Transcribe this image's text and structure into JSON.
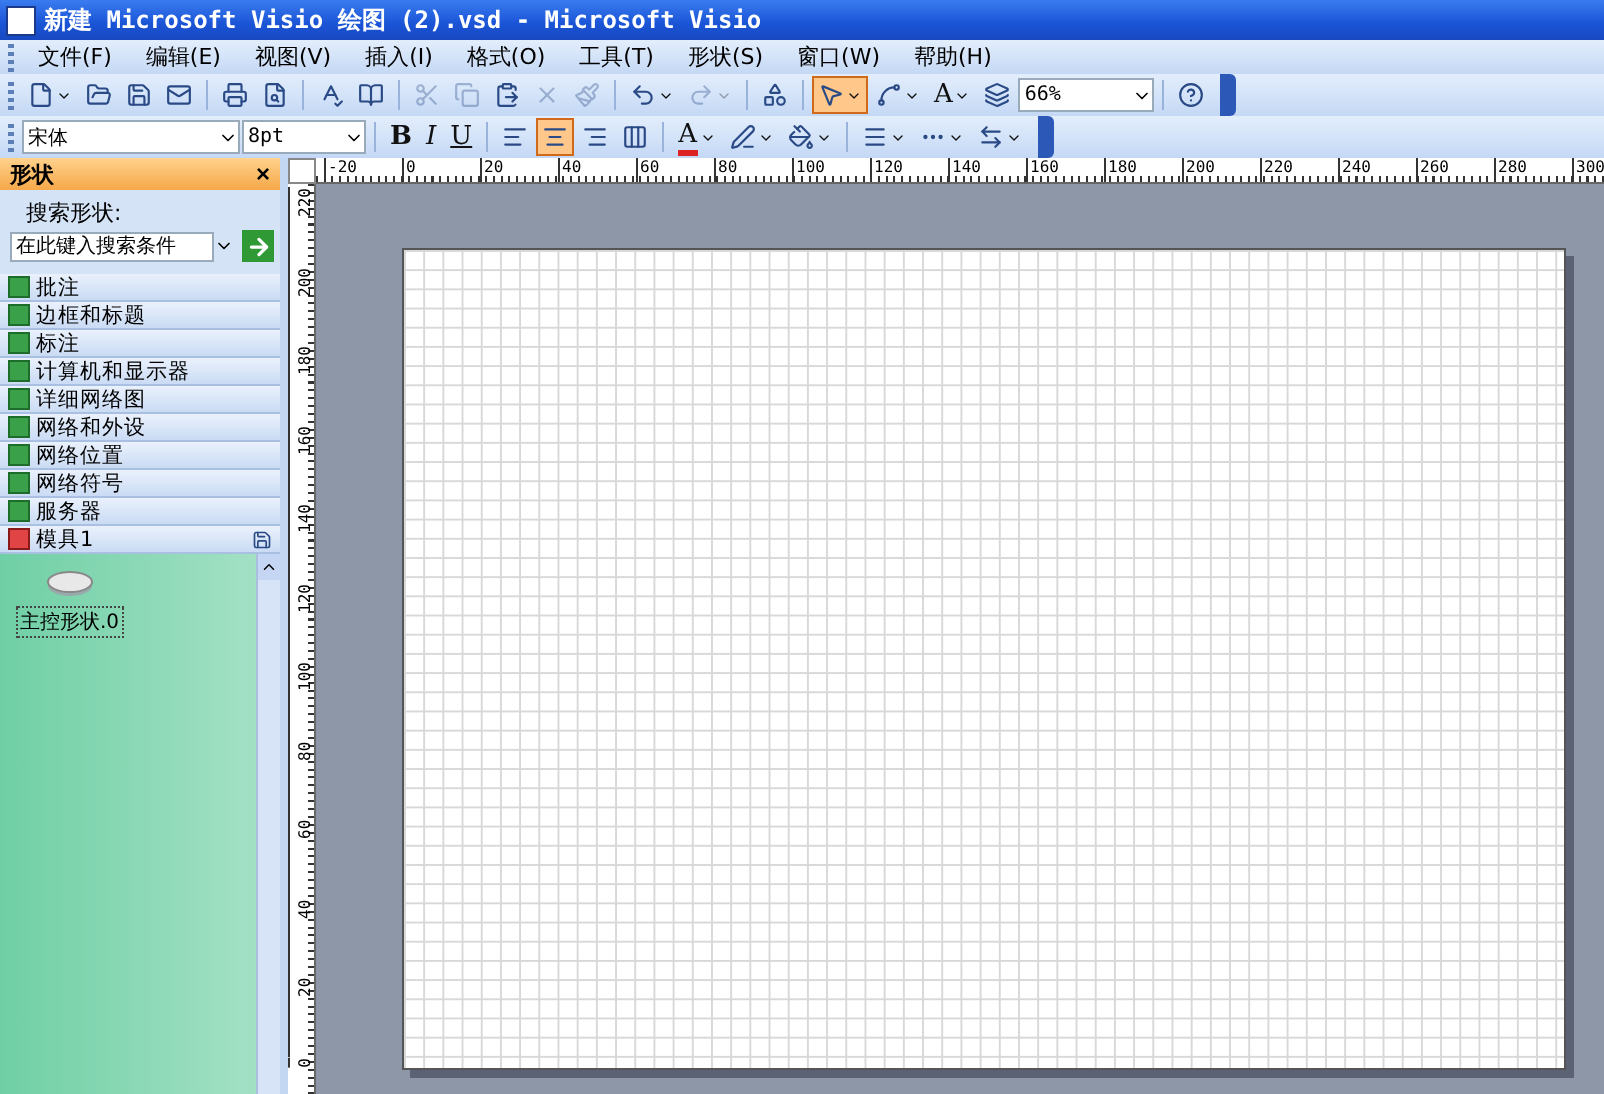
{
  "window": {
    "title": "新建 Microsoft Visio 绘图 (2).vsd - Microsoft Visio"
  },
  "menu": [
    {
      "label": "文件(F)"
    },
    {
      "label": "编辑(E)"
    },
    {
      "label": "视图(V)"
    },
    {
      "label": "插入(I)"
    },
    {
      "label": "格式(O)"
    },
    {
      "label": "工具(T)"
    },
    {
      "label": "形状(S)"
    },
    {
      "label": "窗口(W)"
    },
    {
      "label": "帮助(H)"
    }
  ],
  "standard_toolbar": [
    {
      "kind": "icon",
      "dropdown": true,
      "disabled": false,
      "selected": false
    },
    {
      "kind": "icon",
      "dropdown": false,
      "disabled": false,
      "selected": false
    },
    {
      "kind": "icon",
      "dropdown": false,
      "disabled": false,
      "selected": false
    },
    {
      "kind": "icon",
      "dropdown": false,
      "disabled": false,
      "selected": false
    },
    {
      "kind": "separator"
    },
    {
      "kind": "icon",
      "dropdown": false,
      "disabled": false,
      "selected": false
    },
    {
      "kind": "icon",
      "dropdown": false,
      "disabled": false,
      "selected": false
    },
    {
      "kind": "separator"
    },
    {
      "kind": "icon",
      "dropdown": false,
      "disabled": false,
      "selected": false
    },
    {
      "kind": "icon",
      "dropdown": false,
      "disabled": false,
      "selected": false
    },
    {
      "kind": "separator"
    },
    {
      "kind": "icon",
      "dropdown": false,
      "disabled": true,
      "selected": false
    },
    {
      "kind": "icon",
      "dropdown": false,
      "disabled": true,
      "selected": false
    },
    {
      "kind": "icon",
      "dropdown": false,
      "disabled": false,
      "selected": false
    },
    {
      "kind": "icon",
      "dropdown": false,
      "disabled": true,
      "selected": false
    },
    {
      "kind": "icon",
      "dropdown": false,
      "disabled": true,
      "selected": false
    },
    {
      "kind": "separator"
    },
    {
      "kind": "icon",
      "dropdown": true,
      "disabled": false,
      "selected": false
    },
    {
      "kind": "icon",
      "dropdown": true,
      "disabled": true,
      "selected": false
    },
    {
      "kind": "separator"
    },
    {
      "kind": "icon",
      "dropdown": false,
      "disabled": false,
      "selected": false
    },
    {
      "kind": "separator"
    },
    {
      "kind": "icon",
      "dropdown": true,
      "disabled": false,
      "selected": true
    },
    {
      "kind": "icon",
      "dropdown": true,
      "disabled": false,
      "selected": false
    },
    {
      "kind": "text",
      "label": "A",
      "dropdown": true,
      "disabled": false,
      "selected": false
    },
    {
      "kind": "icon",
      "dropdown": false,
      "disabled": false,
      "selected": false
    },
    {
      "kind": "field",
      "value": "66%"
    },
    {
      "kind": "separator"
    },
    {
      "kind": "icon",
      "dropdown": false,
      "disabled": false,
      "selected": false
    }
  ],
  "formatting_toolbar": [
    {
      "kind": "field",
      "value": "宋体"
    },
    {
      "kind": "field",
      "value": "8pt"
    },
    {
      "kind": "separator"
    },
    {
      "kind": "text",
      "label": "B",
      "dropdown": false,
      "disabled": false,
      "selected": false
    },
    {
      "kind": "text",
      "label": "I",
      "dropdown": false,
      "disabled": false,
      "selected": false
    },
    {
      "kind": "text",
      "label": "U",
      "dropdown": false,
      "disabled": false,
      "selected": false
    },
    {
      "kind": "separator"
    },
    {
      "kind": "icon",
      "dropdown": false,
      "disabled": false,
      "selected": false
    },
    {
      "kind": "icon",
      "dropdown": false,
      "disabled": false,
      "selected": true
    },
    {
      "kind": "icon",
      "dropdown": false,
      "disabled": false,
      "selected": false
    },
    {
      "kind": "icon",
      "dropdown": false,
      "disabled": false,
      "selected": false
    },
    {
      "kind": "separator"
    },
    {
      "kind": "text",
      "label": "A",
      "dropdown": true,
      "disabled": false,
      "selected": false
    },
    {
      "kind": "icon",
      "dropdown": true,
      "disabled": false,
      "selected": false
    },
    {
      "kind": "icon",
      "dropdown": true,
      "disabled": false,
      "selected": false
    },
    {
      "kind": "separator"
    },
    {
      "kind": "icon",
      "dropdown": true,
      "disabled": false,
      "selected": false
    },
    {
      "kind": "icon",
      "dropdown": true,
      "disabled": false,
      "selected": false
    },
    {
      "kind": "icon",
      "dropdown": true,
      "disabled": false,
      "selected": false
    }
  ],
  "shapes_panel": {
    "title": "形状",
    "close": "×",
    "search_label": "搜索形状:",
    "search_placeholder": "在此键入搜索条件",
    "stencils": [
      {
        "label": "批注",
        "selected": false
      },
      {
        "label": "边框和标题",
        "selected": false
      },
      {
        "label": "标注",
        "selected": false
      },
      {
        "label": "计算机和显示器",
        "selected": false
      },
      {
        "label": "详细网络图",
        "selected": false
      },
      {
        "label": "网络和外设",
        "selected": false
      },
      {
        "label": "网络位置",
        "selected": false
      },
      {
        "label": "网络符号",
        "selected": false
      },
      {
        "label": "服务器",
        "selected": false
      }
    ],
    "open_stencil": {
      "label": "模具1",
      "shapes": [
        {
          "label": "主控形状.0"
        }
      ]
    }
  },
  "rulers": {
    "horizontal": [
      "-20",
      "0",
      "20",
      "40",
      "60",
      "80",
      "100",
      "120",
      "140",
      "160",
      "180",
      "200",
      "220",
      "240",
      "260",
      "280",
      "300"
    ],
    "vertical": [
      "220",
      "200",
      "180",
      "160",
      "140",
      "120",
      "100",
      "80",
      "60",
      "40",
      "20",
      "0"
    ]
  }
}
